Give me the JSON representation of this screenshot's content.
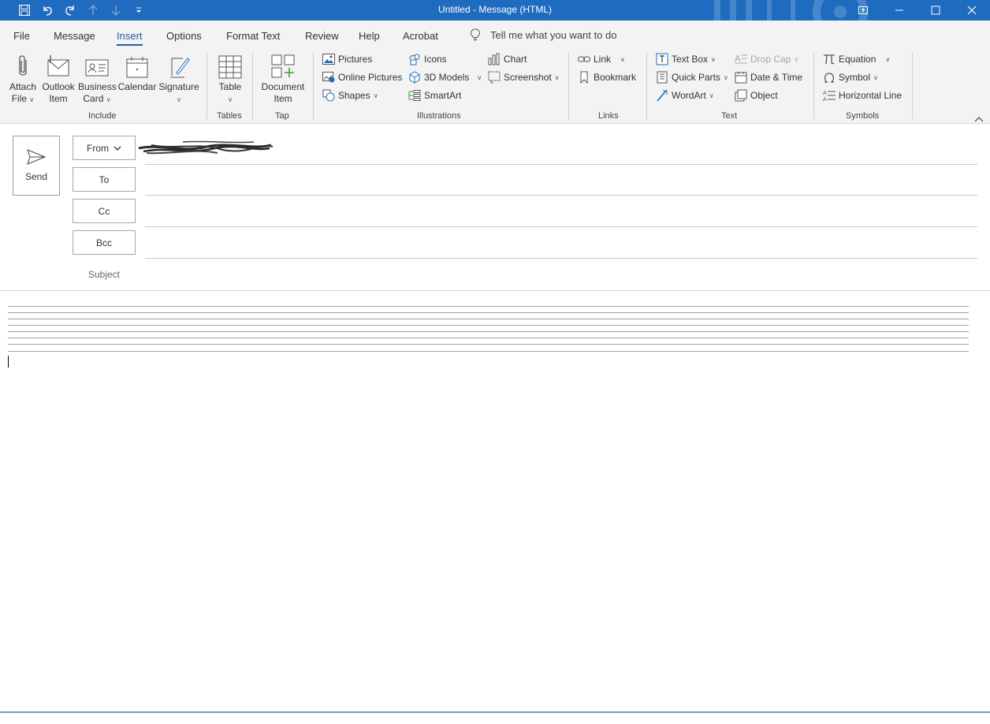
{
  "window": {
    "title": "Untitled  -  Message (HTML)"
  },
  "menu": {
    "tabs": [
      {
        "label": "File"
      },
      {
        "label": "Message"
      },
      {
        "label": "Insert",
        "active": true
      },
      {
        "label": "Options"
      },
      {
        "label": "Format Text"
      },
      {
        "label": "Review"
      },
      {
        "label": "Help"
      },
      {
        "label": "Acrobat"
      }
    ],
    "tell_me": "Tell me what you want to do"
  },
  "ribbon": {
    "include": {
      "label": "Include",
      "attach_file": [
        "Attach",
        "File"
      ],
      "outlook_item": [
        "Outlook",
        "Item"
      ],
      "business_card": [
        "Business",
        "Card"
      ],
      "calendar": "Calendar",
      "signature": "Signature"
    },
    "tables": {
      "label": "Tables",
      "table": "Table"
    },
    "tap": {
      "label": "Tap",
      "document_item": [
        "Document",
        "Item"
      ]
    },
    "illustrations": {
      "label": "Illustrations",
      "pictures": "Pictures",
      "online_pictures": "Online Pictures",
      "shapes": "Shapes",
      "icons": "Icons",
      "models_3d": "3D Models",
      "smartart": "SmartArt",
      "chart": "Chart",
      "screenshot": "Screenshot"
    },
    "links": {
      "label": "Links",
      "link": "Link",
      "bookmark": "Bookmark"
    },
    "text": {
      "label": "Text",
      "text_box": "Text Box",
      "quick_parts": "Quick Parts",
      "wordart": "WordArt",
      "drop_cap": "Drop Cap",
      "date_time": "Date & Time",
      "object": "Object"
    },
    "symbols": {
      "label": "Symbols",
      "equation": "Equation",
      "symbol": "Symbol",
      "horizontal_line": "Horizontal Line"
    }
  },
  "compose": {
    "send": "Send",
    "from": "From",
    "to": "To",
    "cc": "Cc",
    "bcc": "Bcc",
    "subject": "Subject"
  },
  "colors": {
    "titlebar": "#1e6bbf",
    "active_tab": "#1e5ea8",
    "ribbon_bg": "#f3f3f3"
  }
}
